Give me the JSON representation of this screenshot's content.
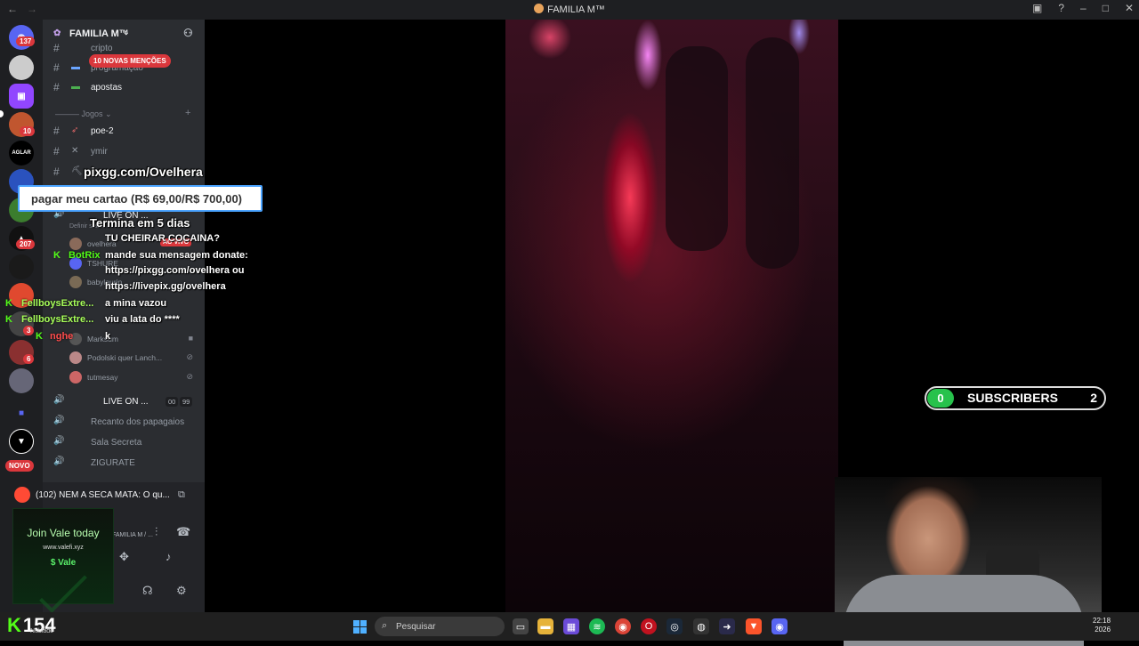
{
  "window": {
    "title": "FAMILIA M™",
    "back_glyph": "←",
    "forward_glyph": "→"
  },
  "guilds": {
    "badges": [
      "137",
      "10",
      "207",
      "3",
      "6"
    ],
    "new_badge": "NOVO"
  },
  "server": {
    "name": "FAMILIA M™",
    "mention_pill": "10 NOVAS MENÇÕES",
    "channels_top": [
      {
        "label": "cripto",
        "icon": "chart-icon"
      },
      {
        "label": "programação",
        "icon": "laptop-icon"
      },
      {
        "label": "apostas",
        "icon": "money-icon"
      }
    ],
    "category_games": "Jogos",
    "channels_games": [
      {
        "label": "poe-2",
        "icon": "bow-icon"
      },
      {
        "label": "ymir",
        "icon": "swords-icon"
      }
    ],
    "voice_live_label": "LIVE ON ...",
    "voice_live_sub": "Definir status",
    "live_badge": "AO VIVO",
    "voice_users": [
      {
        "name": "ovelhera"
      },
      {
        "name": "TSHURE"
      },
      {
        "name": "babylaurin"
      },
      {
        "name": "Marksum"
      },
      {
        "name": "Podolski quer Lanch..."
      },
      {
        "name": "tutmesay"
      }
    ],
    "voice_channels": [
      {
        "label": "LIVE ON ...",
        "count_a": "00",
        "count_b": "99"
      },
      {
        "label": "Recanto dos papagaios"
      },
      {
        "label": "Sala Secreta"
      },
      {
        "label": "ZIGURATE"
      }
    ],
    "activity_text": "(102) NEM A SECA MATA: O qu...",
    "voice_connected": "FAMILIA M / ..."
  },
  "ad": {
    "join": "Join Vale today",
    "url": "www.valefi.xyz",
    "brand": "Vale"
  },
  "overlay": {
    "pix_url": "pixgg.com/Ovelhera",
    "goal_text": "pagar meu cartao (R$ 69,00/R$ 700,00)",
    "goal_term": "Termina em 5 dias",
    "chat": [
      {
        "user": "",
        "text": "TU CHEIRAR COCAINA?"
      },
      {
        "user": "BotRix",
        "text": "mande sua mensagem donate:"
      },
      {
        "user": "",
        "text": "https://pixgg.com/ovelhera ou"
      },
      {
        "user": "",
        "text": "https://livepix.gg/ovelhera"
      },
      {
        "user": "FellboysExtre...",
        "text": "a mina vazou"
      },
      {
        "user": "FellboysExtre...",
        "text": "viu a lata do ****"
      },
      {
        "user": "nghe",
        "text": "k"
      }
    ],
    "subscribers": {
      "left": "0",
      "label": "SUBSCRIBERS",
      "right": "2"
    }
  },
  "taskbar": {
    "viewers": "154",
    "viewers_sub": "Nublado",
    "search_placeholder": "Pesquisar",
    "clock_time": "22:18",
    "clock_date": "2026"
  },
  "colors": {
    "discord_bg": "#2b2d31",
    "kick_green": "#53fc18",
    "badge_red": "#da373c",
    "sub_green": "#27c24c"
  }
}
